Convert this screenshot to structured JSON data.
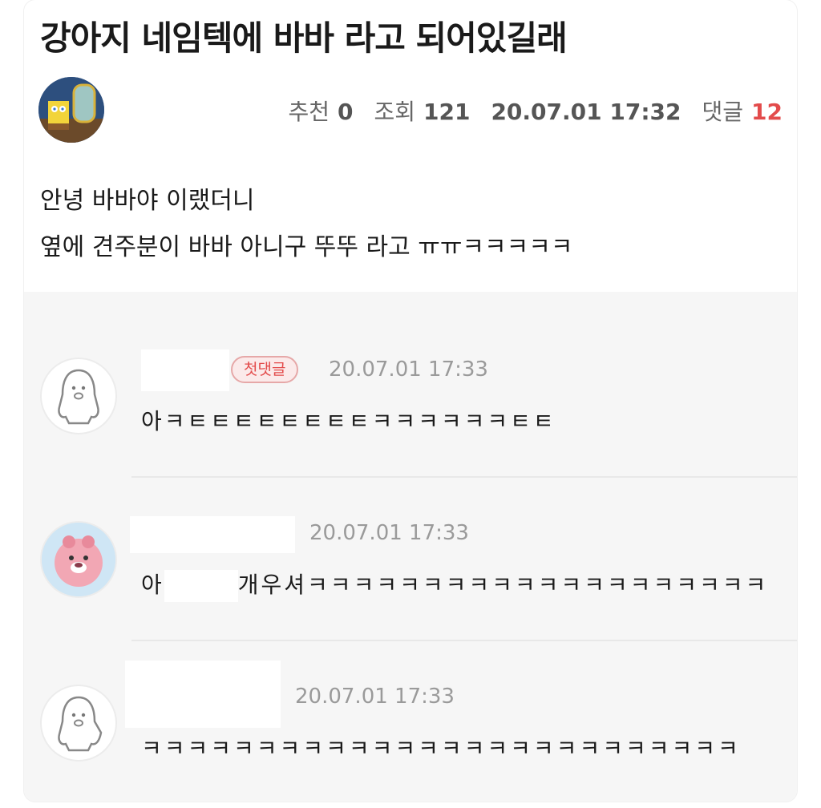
{
  "post": {
    "title": "강아지 네임텍에 바바 라고 되어있길래",
    "meta": {
      "recommend_label": "추천",
      "recommend_value": "0",
      "views_label": "조회",
      "views_value": "121",
      "datetime": "20.07.01 17:32",
      "comments_label": "댓글",
      "comments_value": "12"
    },
    "body_lines": [
      "안녕 바바야 이랬더니",
      "옆에 견주분이 바바 아니구 뚜뚜 라고 ㅠㅠㅋㅋㅋㅋㅋ"
    ]
  },
  "comments": [
    {
      "badge": "첫댓글",
      "datetime": "20.07.01 17:33",
      "text": "아ㅋㅌㅌㅌㅌㅌㅌㅌㅌㅋㅋㅋㅋㅋㅋㅌㅌ"
    },
    {
      "datetime": "20.07.01 17:33",
      "text_prefix": "아",
      "text_suffix": "개우셔ㅋㅋㅋㅋㅋㅋㅋㅋㅋㅋㅋㅋㅋㅋㅋㅋㅋㅋㅋㅋ"
    },
    {
      "datetime": "20.07.01 17:33",
      "text": "ㅋㅋㅋㅋㅋㅋㅋㅋㅋㅋㅋㅋㅋㅋㅋㅋㅋㅋㅋㅋㅋㅋㅋㅋㅋㅋ"
    }
  ],
  "colors": {
    "accent_red": "#e34b4b",
    "comments_bg": "#f6f6f6"
  },
  "icons": [
    "author-avatar-spongebob",
    "penguin-avatar-icon",
    "loopy-beaver-avatar"
  ]
}
